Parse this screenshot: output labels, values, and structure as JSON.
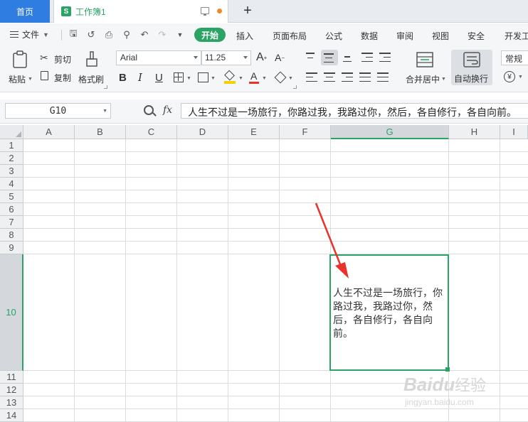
{
  "tabs": {
    "home": "首页",
    "document": "工作簿1",
    "new_tab": "+"
  },
  "menu": {
    "file": "文件",
    "start": "开始",
    "items": [
      "插入",
      "页面布局",
      "公式",
      "数据",
      "审阅",
      "视图",
      "安全",
      "开发工"
    ]
  },
  "ribbon": {
    "paste": "粘贴",
    "cut": "剪切",
    "copy": "复制",
    "format_painter": "格式刷",
    "font_name": "Arial",
    "font_size": "11.25",
    "merge_center": "合并居中",
    "auto_wrap": "自动换行",
    "number_format": "常规"
  },
  "formula_bar": {
    "cell_ref": "G10",
    "fx": "fx",
    "content": "人生不过是一场旅行，你路过我，我路过你，然后，各自修行，各自向前。"
  },
  "grid": {
    "columns": [
      "A",
      "B",
      "C",
      "D",
      "E",
      "F",
      "G",
      "H",
      "I"
    ],
    "rows": [
      "1",
      "2",
      "3",
      "4",
      "5",
      "6",
      "7",
      "8",
      "9",
      "10",
      "11",
      "12",
      "13",
      "14"
    ],
    "selected_column": "G",
    "selected_row": "10",
    "active_cell_text": "人生不过是一场旅行，你路过我，我路过你，然后，各自修行，各自向前。"
  },
  "colors": {
    "accent_green": "#2aa364",
    "tab_blue": "#2f7de1",
    "annotation_red": "#e8332a"
  },
  "watermark": "Baidu经验 jingyan.baidu.com"
}
